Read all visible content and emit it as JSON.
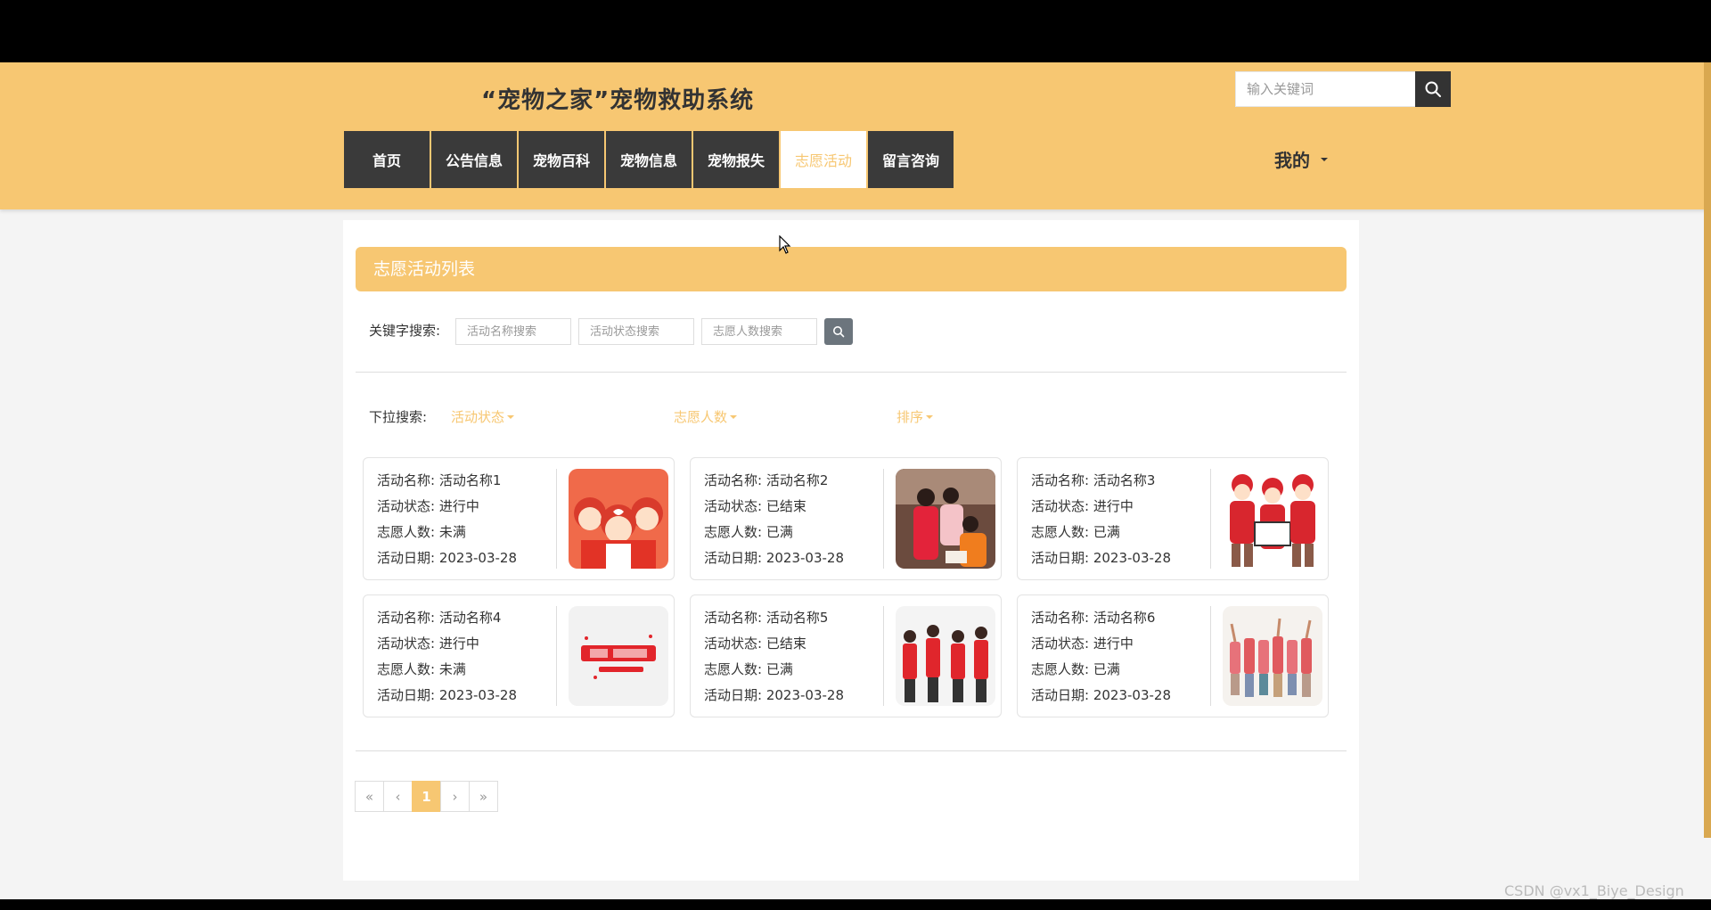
{
  "header": {
    "site_title": "“宠物之家”宠物救助系统",
    "search_placeholder": "输入关键词",
    "user_menu": "我的"
  },
  "nav": {
    "items": [
      {
        "label": "首页",
        "active": false
      },
      {
        "label": "公告信息",
        "active": false
      },
      {
        "label": "宠物百科",
        "active": false
      },
      {
        "label": "宠物信息",
        "active": false
      },
      {
        "label": "宠物报失",
        "active": false
      },
      {
        "label": "志愿活动",
        "active": true
      },
      {
        "label": "留言咨询",
        "active": false
      }
    ]
  },
  "main": {
    "list_title": "志愿活动列表",
    "keyword_search": {
      "label": "关键字搜索:",
      "placeholders": [
        "活动名称搜索",
        "活动状态搜索",
        "志愿人数搜索"
      ]
    },
    "dropdown_search": {
      "label": "下拉搜索:",
      "options": [
        "活动状态",
        "志愿人数",
        "排序"
      ]
    },
    "cards": [
      {
        "name_label": "活动名称:",
        "name": "活动名称1",
        "status_label": "活动状态:",
        "status": "进行中",
        "volunteers_label": "志愿人数:",
        "volunteers": "未满",
        "date_label": "活动日期:",
        "date": "2023-03-28",
        "image_icon": "volunteer-kids-image"
      },
      {
        "name_label": "活动名称:",
        "name": "活动名称2",
        "status_label": "活动状态:",
        "status": "已结束",
        "volunteers_label": "志愿人数:",
        "volunteers": "已满",
        "date_label": "活动日期:",
        "date": "2023-03-28",
        "image_icon": "volunteer-photo-image"
      },
      {
        "name_label": "活动名称:",
        "name": "活动名称3",
        "status_label": "活动状态:",
        "status": "进行中",
        "volunteers_label": "志愿人数:",
        "volunteers": "已满",
        "date_label": "活动日期:",
        "date": "2023-03-28",
        "image_icon": "volunteer-team-image"
      },
      {
        "name_label": "活动名称:",
        "name": "活动名称4",
        "status_label": "活动状态:",
        "status": "进行中",
        "volunteers_label": "志愿人数:",
        "volunteers": "未满",
        "date_label": "活动日期:",
        "date": "2023-03-28",
        "image_icon": "volunteer-banner-image"
      },
      {
        "name_label": "活动名称:",
        "name": "活动名称5",
        "status_label": "活动状态:",
        "status": "已结束",
        "volunteers_label": "志愿人数:",
        "volunteers": "已满",
        "date_label": "活动日期:",
        "date": "2023-03-28",
        "image_icon": "volunteer-group-image"
      },
      {
        "name_label": "活动名称:",
        "name": "活动名称6",
        "status_label": "活动状态:",
        "status": "进行中",
        "volunteers_label": "志愿人数:",
        "volunteers": "已满",
        "date_label": "活动日期:",
        "date": "2023-03-28",
        "image_icon": "volunteer-crowd-image"
      }
    ],
    "pagination": {
      "first": "«",
      "prev": "‹",
      "current": "1",
      "next": "›",
      "last": "»"
    }
  },
  "watermark": "CSDN @vx1_Biye_Design",
  "colors": {
    "accent": "#f7c772",
    "nav_bg": "#3a3a3a",
    "page_bg": "#f4f4f4",
    "search_btn": "#6c757d"
  }
}
